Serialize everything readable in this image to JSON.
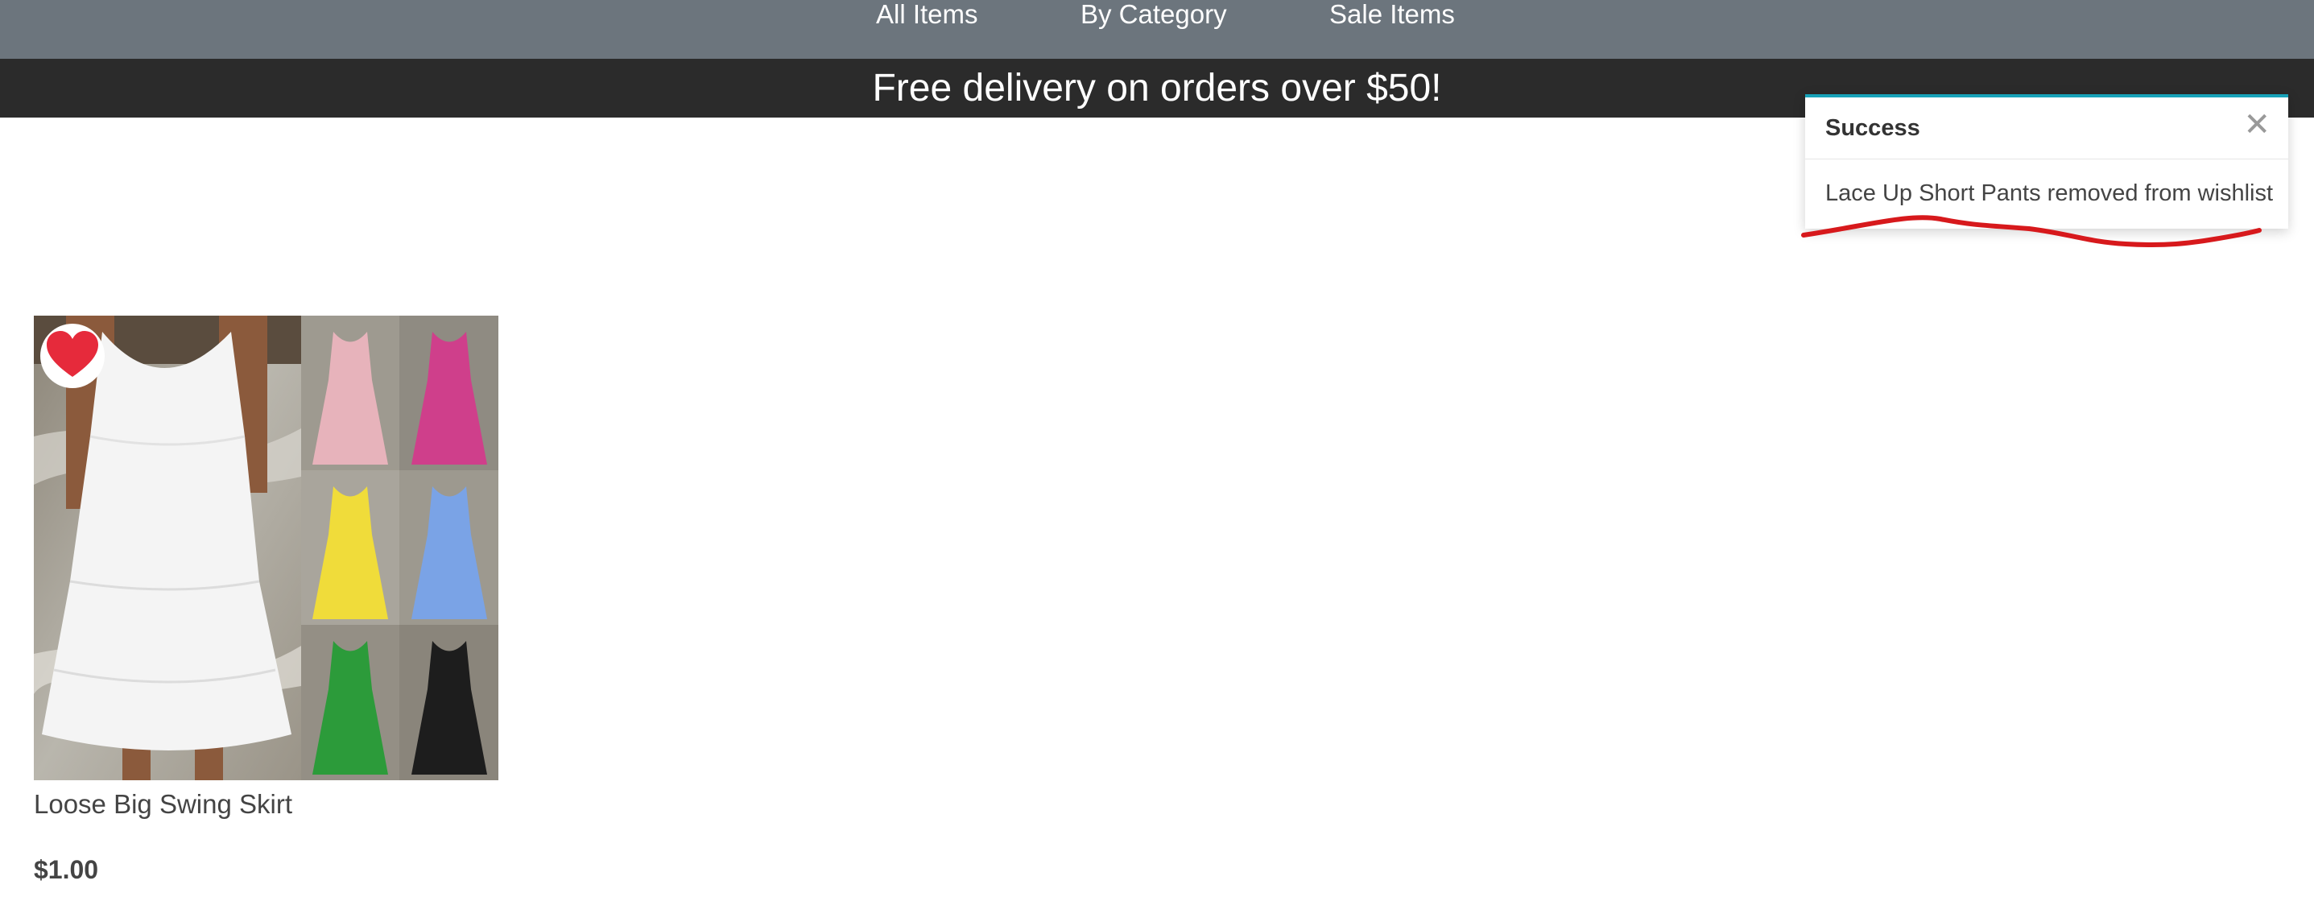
{
  "nav": {
    "items": [
      {
        "label": "All Items"
      },
      {
        "label": "By Category"
      },
      {
        "label": "Sale Items"
      }
    ]
  },
  "banner": {
    "text": "Free delivery on orders over $50!"
  },
  "toast": {
    "title": "Success",
    "message": "Lace Up Short Pants removed from wishlist",
    "close_icon": "close-icon",
    "accent_color": "#17a2b8"
  },
  "annotation": {
    "color": "#d7191c"
  },
  "products": [
    {
      "name": "Loose Big Swing Skirt",
      "price": "$1.00",
      "wishlisted": true,
      "wishlist_icon": "heart-icon",
      "wishlist_color": "#e62a3b"
    }
  ],
  "colors": {
    "nav_background": "#6c757d",
    "banner_background": "#2b2b2b"
  }
}
